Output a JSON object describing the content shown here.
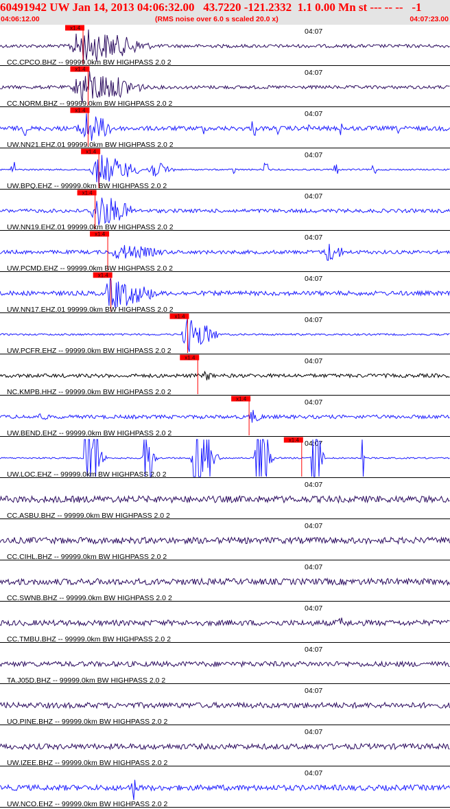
{
  "header": {
    "title": "60491942 UW Jan 14, 2013 04:06:32.00   43.7220 -121.2332  1.1 0.00 Mn st --- -- --   -1",
    "start_time": "04:06:12.00",
    "noise_note": "(RMS noise over 6.0 s scaled 20.0 x)",
    "end_time": "04:07:23.00"
  },
  "colors": {
    "header_text": "#ff0000",
    "header_bg": "#e4e4e4",
    "pick": "#ff0000",
    "trace_navy": "#2a0a5e",
    "trace_blue": "#1a1aff",
    "trace_black": "#000000"
  },
  "chart_data": {
    "type": "line",
    "x_range": [
      "04:06:12.00",
      "04:07:23.00"
    ],
    "time_mark": "04:07",
    "traces": [
      {
        "label": "CC.CPCO.BHZ -- 99999.0km BW  HIGHPASS  2.0  2",
        "pick_label": "x1.4",
        "color": "#2a0a5e",
        "pick_s": 13.1,
        "bursts": [
          [
            10.5,
            25,
            1.0
          ]
        ],
        "noise": 0.09
      },
      {
        "label": "CC.NORM.BHZ -- 99999.0km BW  HIGHPASS  2.0  2",
        "pick_label": "x1.4",
        "color": "#2a0a5e",
        "pick_s": 13.9,
        "bursts": [
          [
            11,
            24,
            1.0
          ]
        ],
        "noise": 0.09
      },
      {
        "label": "UW.NN21.EHZ.01 99999.0km BW  HIGHPASS  2.0  2",
        "pick_label": "x1.4",
        "color": "#1a1aff",
        "pick_s": 13.9,
        "bursts": [
          [
            12,
            19,
            1.0
          ]
        ],
        "noise": 0.12,
        "spikes": [
          [
            4,
            0.4
          ],
          [
            32,
            0.35
          ],
          [
            40,
            0.45
          ],
          [
            44,
            0.35
          ],
          [
            49,
            0.3
          ],
          [
            54,
            0.4
          ],
          [
            63,
            0.35
          ]
        ]
      },
      {
        "label": "UW.BPQ.EHZ -- 99999.0km BW  HIGHPASS  2.0  2",
        "pick_label": "x1.4",
        "color": "#1a1aff",
        "pick_s": 15.6,
        "bursts": [
          [
            14,
            23,
            0.9
          ],
          [
            23,
            28,
            0.5
          ]
        ],
        "noise": 0.04,
        "spikes": [
          [
            2,
            0.5
          ],
          [
            37,
            0.3
          ],
          [
            42,
            0.4
          ],
          [
            53,
            0.3
          ],
          [
            59,
            0.3
          ]
        ]
      },
      {
        "label": "UW.NN19.EHZ.01 99999.0km BW  HIGHPASS  2.0  2",
        "pick_label": "x1.4",
        "color": "#1a1aff",
        "pick_s": 15.0,
        "bursts": [
          [
            14,
            22,
            1.0
          ]
        ],
        "noise": 0.1
      },
      {
        "label": "UW.PCMD.EHZ -- 99999.0km BW  HIGHPASS  2.0  2",
        "pick_label": "x1.4",
        "color": "#1a1aff",
        "pick_s": 17.0,
        "bursts": [
          [
            17,
            28,
            0.45
          ],
          [
            51,
            55,
            0.6
          ]
        ],
        "noise": 0.1
      },
      {
        "label": "UW.NN17.EHZ.01 99999.0km BW  HIGHPASS  2.0  2",
        "pick_label": "x1.4",
        "color": "#1a1aff",
        "pick_s": 17.5,
        "bursts": [
          [
            16,
            26,
            0.9
          ]
        ],
        "noise": 0.12
      },
      {
        "label": "UW.PCFR.EHZ -- 99999.0km BW  HIGHPASS  2.0  2",
        "pick_label": "x1.4",
        "color": "#1a1aff",
        "pick_s": 29.6,
        "bursts": [
          [
            28.5,
            35,
            1.0
          ]
        ],
        "noise": 0.05
      },
      {
        "label": "NC.KMPB.HHZ -- 99999.0km BW  HIGHPASS  2.0  2",
        "pick_label": "x1.4",
        "color": "#000000",
        "pick_s": 31.2,
        "bursts": [
          [
            32,
            34,
            0.35
          ]
        ],
        "noise": 0.1
      },
      {
        "label": "UW.BEND.EHZ -- 99999.0km BW  HIGHPASS  2.0  2",
        "pick_label": "x1.4",
        "color": "#1a1aff",
        "pick_s": 39.3,
        "bursts": [
          [
            39,
            42,
            0.45
          ],
          [
            6,
            8,
            0.3
          ]
        ],
        "noise": 0.1
      },
      {
        "label": "UW.LOC.EHZ -- 99999.0km BW  HIGHPASS  2.0  2",
        "pick_label": "x1.4",
        "color": "#1a1aff",
        "pick_s": 47.6,
        "bursts": [
          [
            13,
            17,
            1.0
          ],
          [
            22.5,
            25,
            1.0
          ],
          [
            30,
            35,
            1.0
          ],
          [
            40,
            43.5,
            1.0
          ],
          [
            49,
            51.5,
            1.0
          ],
          [
            57,
            57.5,
            1.0
          ]
        ],
        "noise": 0.04,
        "clipped": true
      },
      {
        "label": "CC.ASBU.BHZ -- 99999.0km BW  HIGHPASS  2.0  2",
        "color": "#2a0a5e",
        "bursts": [],
        "noise": 0.18
      },
      {
        "label": "CC.CIHL.BHZ -- 99999.0km BW  HIGHPASS  2.0  2",
        "color": "#2a0a5e",
        "bursts": [],
        "noise": 0.17
      },
      {
        "label": "CC.SWNB.BHZ -- 99999.0km BW  HIGHPASS  2.0  2",
        "color": "#2a0a5e",
        "bursts": [],
        "noise": 0.17
      },
      {
        "label": "CC.TMBU.BHZ -- 99999.0km BW  HIGHPASS  2.0  2",
        "color": "#2a0a5e",
        "bursts": [
          [
            53,
            56,
            0.35
          ]
        ],
        "noise": 0.15
      },
      {
        "label": "TA.J05D.BHZ -- 99999.0km BW  HIGHPASS  2.0  2",
        "color": "#2a0a5e",
        "bursts": [],
        "noise": 0.14
      },
      {
        "label": "UO.PINE.BHZ -- 99999.0km BW  HIGHPASS  2.0  2",
        "color": "#2a0a5e",
        "bursts": [],
        "noise": 0.15
      },
      {
        "label": "UW.IZEE.BHZ -- 99999.0km BW  HIGHPASS  2.0  2",
        "color": "#2a0a5e",
        "bursts": [],
        "noise": 0.15
      },
      {
        "label": "UW.NCO.EHZ -- 99999.0km BW  HIGHPASS  2.0  2",
        "color": "#1a1aff",
        "bursts": [],
        "noise": 0.15,
        "spikes": [
          [
            21,
            0.9
          ]
        ]
      }
    ]
  }
}
